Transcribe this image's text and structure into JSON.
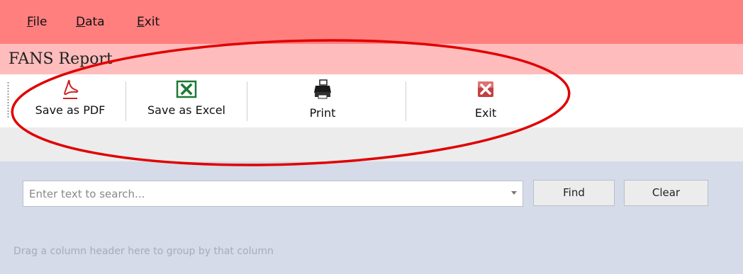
{
  "menu": {
    "items": [
      {
        "label": "File",
        "underline": "F",
        "rest": "ile"
      },
      {
        "label": "Data",
        "underline": "D",
        "rest": "ata"
      },
      {
        "label": "Exit",
        "underline": "E",
        "rest": "xit"
      }
    ]
  },
  "report_title": "FANS Report",
  "toolbar": {
    "buttons": [
      {
        "label": "Save as PDF",
        "icon": "pdf-icon"
      },
      {
        "label": "Save as Excel",
        "icon": "excel-icon"
      },
      {
        "label": "Print",
        "icon": "printer-icon"
      },
      {
        "label": "Exit",
        "icon": "exit-icon"
      }
    ]
  },
  "search": {
    "placeholder": "Enter text to search...",
    "find_label": "Find",
    "clear_label": "Clear"
  },
  "group_panel": {
    "hint": "Drag a column header here to group by that column"
  },
  "colors": {
    "menubar": "#ff7f7f",
    "titlebar": "#ffbcbc",
    "annotation": "#e00000",
    "search_panel": "#d5dbe8"
  }
}
